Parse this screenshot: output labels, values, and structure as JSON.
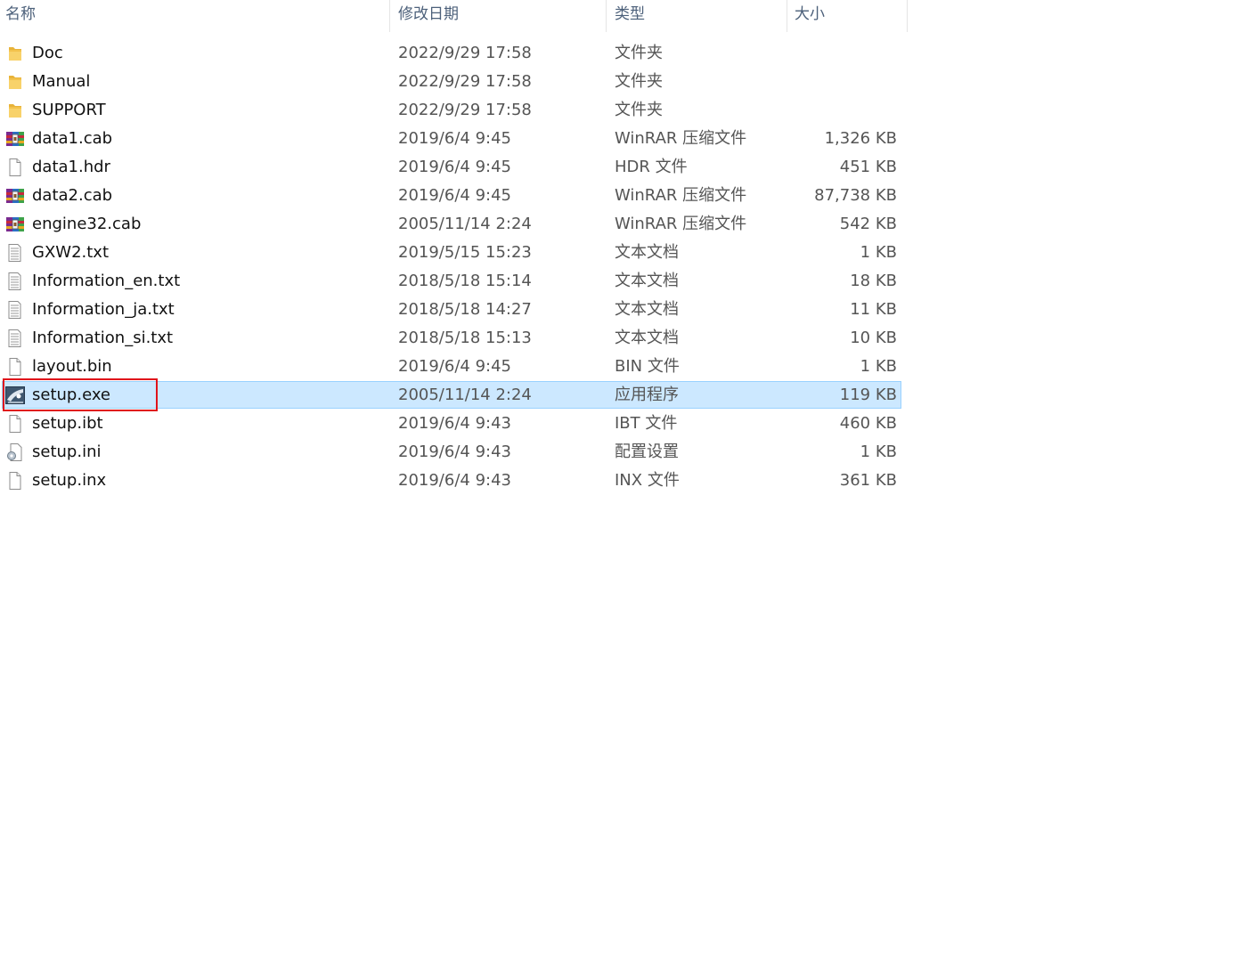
{
  "columns": {
    "name": "名称",
    "date": "修改日期",
    "type": "类型",
    "size": "大小"
  },
  "files": [
    {
      "name": "Doc",
      "date": "2022/9/29 17:58",
      "type": "文件夹",
      "size": "",
      "icon": "folder-icon"
    },
    {
      "name": "Manual",
      "date": "2022/9/29 17:58",
      "type": "文件夹",
      "size": "",
      "icon": "folder-icon"
    },
    {
      "name": "SUPPORT",
      "date": "2022/9/29 17:58",
      "type": "文件夹",
      "size": "",
      "icon": "folder-icon"
    },
    {
      "name": "data1.cab",
      "date": "2019/6/4 9:45",
      "type": "WinRAR 压缩文件",
      "size": "1,326 KB",
      "icon": "winrar-icon"
    },
    {
      "name": "data1.hdr",
      "date": "2019/6/4 9:45",
      "type": "HDR 文件",
      "size": "451 KB",
      "icon": "blank-file-icon"
    },
    {
      "name": "data2.cab",
      "date": "2019/6/4 9:45",
      "type": "WinRAR 压缩文件",
      "size": "87,738 KB",
      "icon": "winrar-icon"
    },
    {
      "name": "engine32.cab",
      "date": "2005/11/14 2:24",
      "type": "WinRAR 压缩文件",
      "size": "542 KB",
      "icon": "winrar-icon"
    },
    {
      "name": "GXW2.txt",
      "date": "2019/5/15 15:23",
      "type": "文本文档",
      "size": "1 KB",
      "icon": "text-file-icon"
    },
    {
      "name": "Information_en.txt",
      "date": "2018/5/18 15:14",
      "type": "文本文档",
      "size": "18 KB",
      "icon": "text-file-icon"
    },
    {
      "name": "Information_ja.txt",
      "date": "2018/5/18 14:27",
      "type": "文本文档",
      "size": "11 KB",
      "icon": "text-file-icon"
    },
    {
      "name": "Information_si.txt",
      "date": "2018/5/18 15:13",
      "type": "文本文档",
      "size": "10 KB",
      "icon": "text-file-icon"
    },
    {
      "name": "layout.bin",
      "date": "2019/6/4 9:45",
      "type": "BIN 文件",
      "size": "1 KB",
      "icon": "blank-file-icon"
    },
    {
      "name": "setup.exe",
      "date": "2005/11/14 2:24",
      "type": "应用程序",
      "size": "119 KB",
      "icon": "setup-exe-icon",
      "selected": true
    },
    {
      "name": "setup.ibt",
      "date": "2019/6/4 9:43",
      "type": "IBT 文件",
      "size": "460 KB",
      "icon": "blank-file-icon"
    },
    {
      "name": "setup.ini",
      "date": "2019/6/4 9:43",
      "type": "配置设置",
      "size": "1 KB",
      "icon": "settings-file-icon"
    },
    {
      "name": "setup.inx",
      "date": "2019/6/4 9:43",
      "type": "INX 文件",
      "size": "361 KB",
      "icon": "blank-file-icon"
    }
  ],
  "colors": {
    "selection_bg": "#cce8ff",
    "selection_border": "#99d1ff",
    "highlight_box": "#e0141b",
    "header_text": "#4c607a"
  }
}
